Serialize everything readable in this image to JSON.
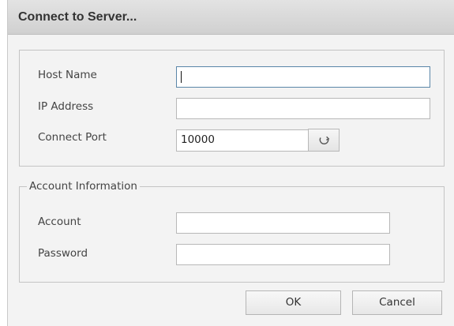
{
  "window": {
    "title": "Connect to Server..."
  },
  "server": {
    "host_name_label": "Host Name",
    "host_name_value": "",
    "ip_address_label": "IP Address",
    "ip_address_value": "",
    "port_label": "Connect Port",
    "port_value": "10000",
    "refresh_icon": "refresh-icon"
  },
  "account": {
    "group_title": "Account Information",
    "account_label": "Account",
    "account_value": "",
    "password_label": "Password",
    "password_value": ""
  },
  "buttons": {
    "ok_label": "OK",
    "cancel_label": "Cancel"
  },
  "colors": {
    "focus_border": "#5a86a8",
    "window_background": "#f3f3f3"
  }
}
